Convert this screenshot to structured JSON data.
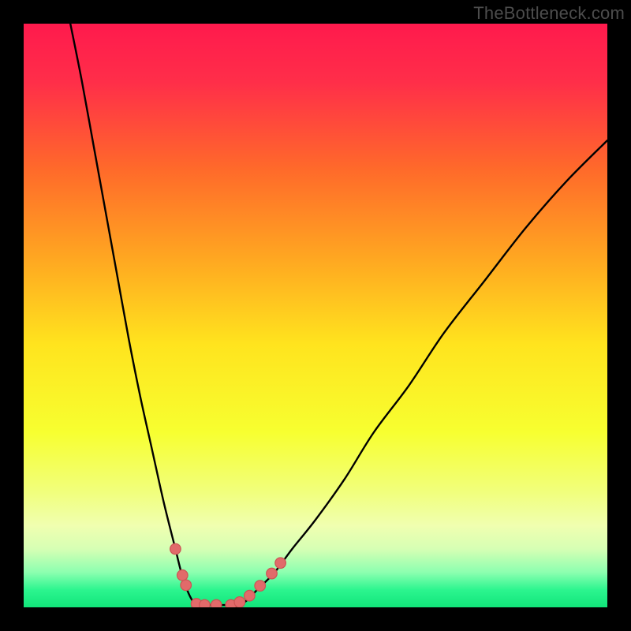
{
  "watermark": "TheBottleneck.com",
  "chart_data": {
    "type": "line",
    "title": "",
    "xlabel": "",
    "ylabel": "",
    "xlim": [
      0,
      100
    ],
    "ylim": [
      0,
      100
    ],
    "gradient_stops": [
      {
        "offset": 0.0,
        "color": "#ff1a4d"
      },
      {
        "offset": 0.1,
        "color": "#ff2e49"
      },
      {
        "offset": 0.25,
        "color": "#ff6a2a"
      },
      {
        "offset": 0.4,
        "color": "#ffa621"
      },
      {
        "offset": 0.55,
        "color": "#ffe41e"
      },
      {
        "offset": 0.7,
        "color": "#f7ff30"
      },
      {
        "offset": 0.8,
        "color": "#f1ff7a"
      },
      {
        "offset": 0.86,
        "color": "#f0ffb0"
      },
      {
        "offset": 0.9,
        "color": "#d6ffb4"
      },
      {
        "offset": 0.94,
        "color": "#8cffb0"
      },
      {
        "offset": 0.97,
        "color": "#2cf58f"
      },
      {
        "offset": 1.0,
        "color": "#11e57a"
      }
    ],
    "series": [
      {
        "name": "left-curve",
        "x": [
          8,
          10,
          12,
          14,
          16,
          18,
          20,
          22,
          24,
          26,
          27,
          28,
          29,
          30
        ],
        "y": [
          100,
          90,
          79,
          68,
          57,
          46,
          36,
          27,
          18,
          10,
          6,
          3,
          1,
          0
        ]
      },
      {
        "name": "right-curve",
        "x": [
          36,
          38,
          40,
          43,
          46,
          50,
          55,
          60,
          66,
          72,
          79,
          86,
          93,
          100
        ],
        "y": [
          0,
          1,
          3,
          6,
          10,
          15,
          22,
          30,
          38,
          47,
          56,
          65,
          73,
          80
        ]
      }
    ],
    "flat_segment": {
      "x0": 30,
      "x1": 36,
      "y": 0.4
    },
    "markers": [
      {
        "series": "left-curve",
        "x": 26.0,
        "y": 10.0
      },
      {
        "series": "left-curve",
        "x": 27.2,
        "y": 5.5
      },
      {
        "series": "left-curve",
        "x": 27.8,
        "y": 3.8
      },
      {
        "series": "left-curve",
        "x": 29.6,
        "y": 0.6
      },
      {
        "series": "left-curve",
        "x": 31.0,
        "y": 0.4
      },
      {
        "series": "flat",
        "x": 33.0,
        "y": 0.4
      },
      {
        "series": "right-curve",
        "x": 35.5,
        "y": 0.4
      },
      {
        "series": "right-curve",
        "x": 37.0,
        "y": 0.9
      },
      {
        "series": "right-curve",
        "x": 38.7,
        "y": 2.0
      },
      {
        "series": "right-curve",
        "x": 40.5,
        "y": 3.7
      },
      {
        "series": "right-curve",
        "x": 42.5,
        "y": 5.8
      },
      {
        "series": "right-curve",
        "x": 44.0,
        "y": 7.6
      }
    ],
    "marker_style": {
      "r": 6.8,
      "fill": "#e16a6a",
      "stroke": "#cc5454",
      "stroke_width": 1.2
    }
  }
}
